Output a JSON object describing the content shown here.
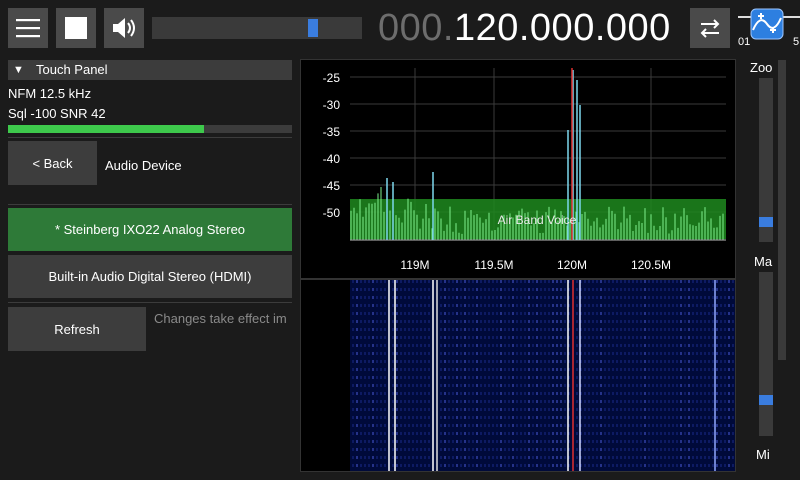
{
  "toolbar": {
    "menu_icon": "hamburger-menu-icon",
    "stop_icon": "stop-square-icon",
    "volume_icon": "speaker-volume-icon",
    "volume_level": 0.78,
    "freq_prefix": "000.",
    "freq_main": "120.000.000",
    "swap_icon": "swap-arrows-icon",
    "mini_scale_left": "01",
    "mini_scale_right": "5",
    "app_icon": "sdr-app-icon"
  },
  "panel": {
    "title": "Touch Panel",
    "mode_line": "NFM  12.5 kHz",
    "sql_line": "Sql -100  SNR 42",
    "signal_level": 0.69,
    "back_label": "< Back",
    "section_title": "Audio Device",
    "devices": [
      {
        "label": "* Steinberg IXO22 Analog Stereo",
        "selected": true
      },
      {
        "label": "Built-in Audio Digital Stereo (HDMI)",
        "selected": false
      }
    ],
    "refresh_label": "Refresh",
    "note": "Changes take effect im"
  },
  "spectrum": {
    "y_ticks": [
      "-25",
      "-30",
      "-35",
      "-40",
      "-45",
      "-50"
    ],
    "x_ticks": [
      "119M",
      "119.5M",
      "120M",
      "120.5M"
    ],
    "band_label": "Air Band Voice",
    "colors": {
      "band": "#1f8a1f",
      "trace": "#7dee8c",
      "peak": "#e03030",
      "accent": "#3a7ddf"
    }
  },
  "right": {
    "zoom_label": "Zoo",
    "max_label": "Ma",
    "min_label": "Mi",
    "zoom_level": 0.1,
    "max_level": 0.2
  }
}
